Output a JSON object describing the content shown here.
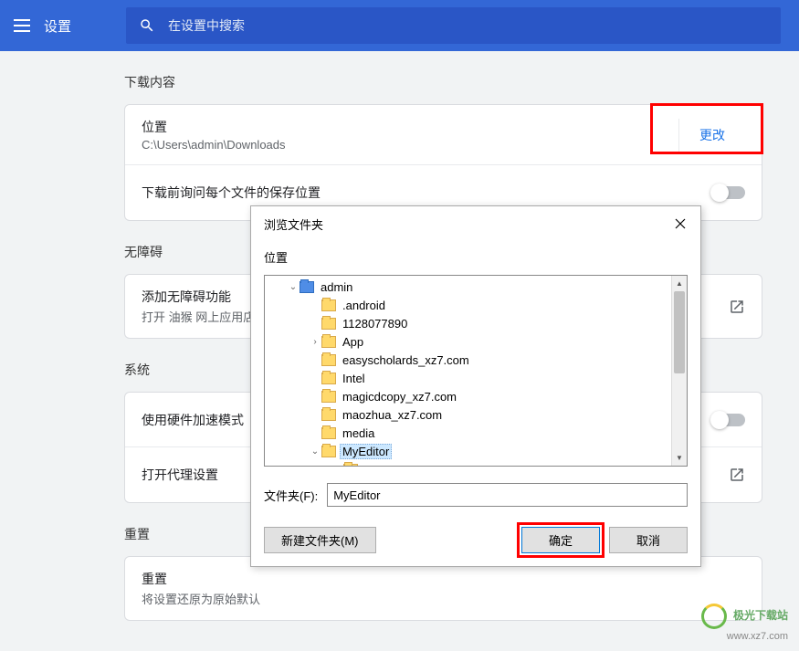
{
  "header": {
    "title": "设置",
    "search_placeholder": "在设置中搜索"
  },
  "sections": {
    "downloads": {
      "title": "下载内容",
      "location_label": "位置",
      "location_path": "C:\\Users\\admin\\Downloads",
      "change_btn": "更改",
      "ask_label": "下载前询问每个文件的保存位置"
    },
    "accessibility": {
      "title": "无障碍",
      "add_label": "添加无障碍功能",
      "add_sub": "打开 油猴 网上应用店"
    },
    "system": {
      "title": "系统",
      "hw_label": "使用硬件加速模式（如",
      "proxy_label": "打开代理设置"
    },
    "reset": {
      "title": "重置",
      "reset_label": "重置",
      "reset_sub": "将设置还原为原始默认"
    }
  },
  "dialog": {
    "title": "浏览文件夹",
    "location_label": "位置",
    "tree": [
      {
        "level": 1,
        "arrow": "v",
        "icon": "blue",
        "text": "admin"
      },
      {
        "level": 2,
        "arrow": "",
        "icon": "folder",
        "text": ".android"
      },
      {
        "level": 2,
        "arrow": "",
        "icon": "folder",
        "text": "1128077890"
      },
      {
        "level": 2,
        "arrow": ">",
        "icon": "folder",
        "text": "App"
      },
      {
        "level": 2,
        "arrow": "",
        "icon": "folder",
        "text": "easyscholards_xz7.com"
      },
      {
        "level": 2,
        "arrow": "",
        "icon": "folder",
        "text": "Intel"
      },
      {
        "level": 2,
        "arrow": "",
        "icon": "folder",
        "text": "magicdcopy_xz7.com"
      },
      {
        "level": 2,
        "arrow": "",
        "icon": "folder",
        "text": "maozhua_xz7.com"
      },
      {
        "level": 2,
        "arrow": "",
        "icon": "folder",
        "text": "media"
      },
      {
        "level": 2,
        "arrow": "v",
        "icon": "folder",
        "text": "MyEditor",
        "selected": true
      },
      {
        "level": 3,
        "arrow": "",
        "icon": "folder",
        "text": ""
      }
    ],
    "folder_label": "文件夹(F):",
    "folder_value": "MyEditor",
    "new_folder_btn": "新建文件夹(M)",
    "ok_btn": "确定",
    "cancel_btn": "取消"
  },
  "watermark": {
    "title": "极光下载站",
    "url": "www.xz7.com"
  }
}
